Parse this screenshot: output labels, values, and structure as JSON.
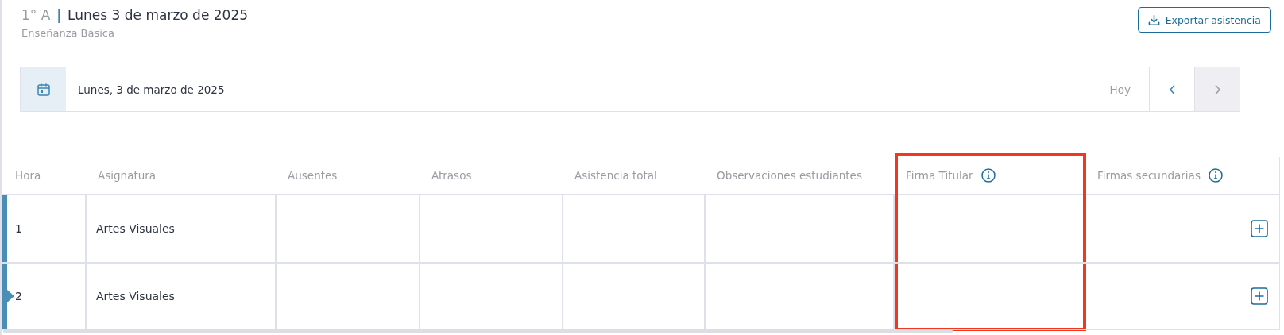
{
  "header": {
    "course": "1° A",
    "separator": "|",
    "date_title": "Lunes 3 de marzo de 2025",
    "level": "Enseñanza Básica"
  },
  "export_button": {
    "label": "Exportar asistencia"
  },
  "date_bar": {
    "date": "Lunes, 3 de marzo de 2025",
    "today": "Hoy",
    "prev_disabled": false,
    "next_disabled": true
  },
  "table": {
    "columns": [
      {
        "label": "Hora",
        "info": false,
        "highlighted": false
      },
      {
        "label": "Asignatura",
        "info": false,
        "highlighted": false
      },
      {
        "label": "Ausentes",
        "info": false,
        "highlighted": false
      },
      {
        "label": "Atrasos",
        "info": false,
        "highlighted": false
      },
      {
        "label": "Asistencia total",
        "info": false,
        "highlighted": false
      },
      {
        "label": "Observaciones estudiantes",
        "info": false,
        "highlighted": false
      },
      {
        "label": "Firma Titular",
        "info": true,
        "highlighted": true
      },
      {
        "label": "Firmas secundarias",
        "info": true,
        "highlighted": false
      }
    ],
    "rows": [
      {
        "hora": "1",
        "asignatura": "Artes Visuales",
        "current": false,
        "add_button": true
      },
      {
        "hora": "2",
        "asignatura": "Artes Visuales",
        "current": true,
        "add_button": true
      }
    ]
  }
}
